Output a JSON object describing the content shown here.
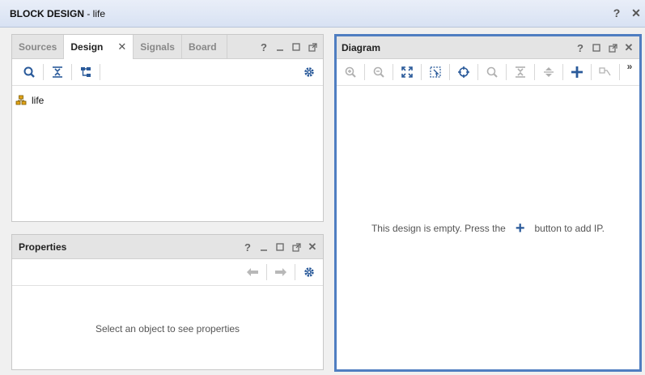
{
  "window": {
    "title_bold": "BLOCK DESIGN",
    "title_rest": " - life"
  },
  "sources_panel": {
    "tabs": [
      {
        "label": "Sources"
      },
      {
        "label": "Design",
        "close": "✕"
      },
      {
        "label": "Signals"
      },
      {
        "label": "Board"
      }
    ],
    "tree": [
      {
        "label": "life"
      }
    ]
  },
  "properties_panel": {
    "title": "Properties",
    "empty_message": "Select an object to see properties"
  },
  "diagram_panel": {
    "title": "Diagram",
    "more": "»",
    "empty_before": "This design is empty. Press the",
    "empty_plus": "+",
    "empty_after": "button to add IP."
  },
  "header_controls": {
    "help": "?",
    "close": "✕"
  },
  "colors": {
    "accent": "#3e6fb5",
    "icon_blue": "#2a5a9a"
  }
}
